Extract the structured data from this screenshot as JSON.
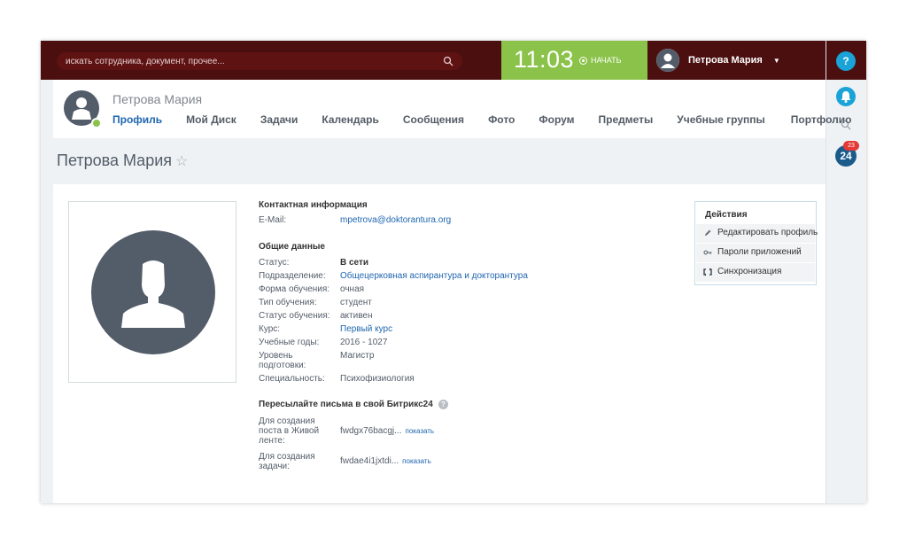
{
  "search": {
    "placeholder": "искать сотрудника, документ, прочее..."
  },
  "clock": {
    "time": "11:03",
    "start_label": "НАЧАТЬ"
  },
  "user": {
    "name": "Петрова Мария"
  },
  "rail": {
    "help_label": "?",
    "b24_label": "24",
    "b24_badge": "23"
  },
  "profile": {
    "header_name": "Петрова Мария",
    "tabs": [
      "Профиль",
      "Мой Диск",
      "Задачи",
      "Календарь",
      "Сообщения",
      "Фото",
      "Форум",
      "Предметы",
      "Учебные группы",
      "Портфолио"
    ],
    "page_title": "Петрова Мария",
    "star": "☆"
  },
  "contact": {
    "title": "Контактная информация",
    "email_label": "E-Mail:",
    "email": "mpetrova@doktorantura.org"
  },
  "general": {
    "title": "Общие данные",
    "rows": [
      {
        "label": "Статус:",
        "value": "В сети"
      },
      {
        "label": "Подразделение:",
        "value": "Общецерковная аспирантура и докторантура"
      },
      {
        "label": "Форма обучения:",
        "value": "очная"
      },
      {
        "label": "Тип обучения:",
        "value": "студент"
      },
      {
        "label": "Статус обучения:",
        "value": "активен"
      },
      {
        "label": "Курс:",
        "value": "Первый курс"
      },
      {
        "label": "Учебные годы:",
        "value": "2016 - 1027"
      },
      {
        "label": "Уровень подготовки:",
        "value": "Магистр"
      },
      {
        "label": "Специальность:",
        "value": "Психофизиология"
      }
    ]
  },
  "forward": {
    "title": "Пересылайте письма в свой Битрикс24",
    "help": "?",
    "rows": [
      {
        "label": "Для создания поста в Живой ленте:",
        "value": "fwdgx76bacgj...",
        "show": "показать"
      },
      {
        "label": "Для создания задачи:",
        "value": "fwdae4i1jxtdi...",
        "show": "показать"
      }
    ]
  },
  "actions": {
    "title": "Действия",
    "items": [
      {
        "label": "Редактировать профиль",
        "icon": "pencil-icon"
      },
      {
        "label": "Пароли приложений",
        "icon": "key-icon"
      },
      {
        "label": "Синхронизация",
        "icon": "sync-icon"
      }
    ]
  }
}
